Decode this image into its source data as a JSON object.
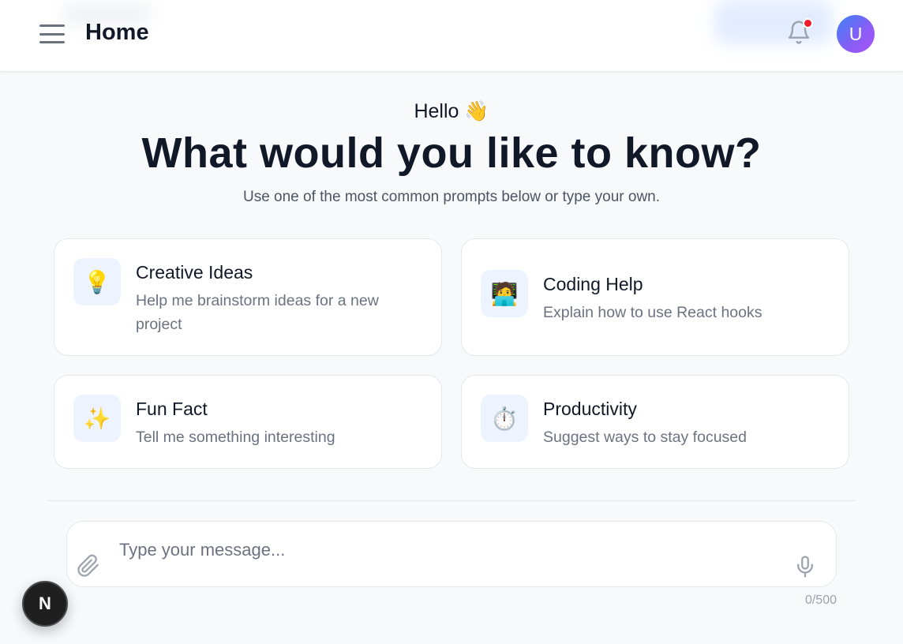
{
  "header": {
    "title": "Home",
    "avatar_letter": "U",
    "icons": {
      "menu": "hamburger-menu-icon",
      "notifications": "bell-icon"
    }
  },
  "hero": {
    "greeting": "Hello",
    "greeting_emoji": "👋",
    "headline": "What would you like to know?",
    "subtitle": "Use one of the most common prompts below or type your own."
  },
  "prompts": [
    {
      "icon": "💡",
      "icon_name": "lightbulb-icon",
      "title": "Creative Ideas",
      "description": "Help me brainstorm ideas for a new project"
    },
    {
      "icon": "🧑‍💻",
      "icon_name": "technologist-icon",
      "title": "Coding Help",
      "description": "Explain how to use React hooks"
    },
    {
      "icon": "✨",
      "icon_name": "sparkles-icon",
      "title": "Fun Fact",
      "description": "Tell me something interesting"
    },
    {
      "icon": "⏱️",
      "icon_name": "stopwatch-icon",
      "title": "Productivity",
      "description": "Suggest ways to stay focused"
    }
  ],
  "composer": {
    "placeholder": "Type your message...",
    "value": "",
    "char_count": "0/500",
    "icons": {
      "attach": "paperclip-icon",
      "voice": "microphone-icon"
    }
  },
  "badge": {
    "letter": "N"
  },
  "colors": {
    "accent": "#3b82f6",
    "avatar_gradient_end": "#a855f7",
    "notification_dot": "#ef1b2d",
    "card_icon_bg": "#eef4ff"
  }
}
